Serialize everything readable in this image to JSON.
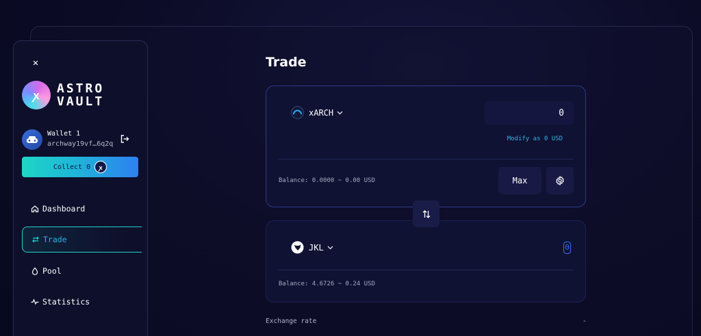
{
  "sidebar": {
    "logo_line1": "ASTRO",
    "logo_line2": "VAULT",
    "logo_mark": "ꭗ",
    "wallet": {
      "name": "Wallet 1",
      "address": "archway19vf…6q2q"
    },
    "collect_label": "Collect 0",
    "nav": [
      {
        "label": "Dashboard",
        "icon": "home-icon"
      },
      {
        "label": "Trade",
        "icon": "swap-arrows-icon",
        "active": true
      },
      {
        "label": "Pool",
        "icon": "drop-icon"
      },
      {
        "label": "Statistics",
        "icon": "activity-icon"
      }
    ]
  },
  "main": {
    "title": "Trade",
    "from": {
      "token": "xARCH",
      "amount": "0",
      "modify_label": "Modify as 0 USD",
      "balance": "Balance: 0.0000 ~ 0.00 USD",
      "max_label": "Max"
    },
    "to": {
      "token": "JKL",
      "amount": "0",
      "balance": "Balance: 4.6726 ~ 0.24 USD"
    },
    "exchange_rate_label": "Exchange rate",
    "exchange_rate_value": "-"
  },
  "colors": {
    "accent_cyan": "#20d4c6",
    "accent_blue": "#2db0ea",
    "background": "#0b0b25"
  }
}
